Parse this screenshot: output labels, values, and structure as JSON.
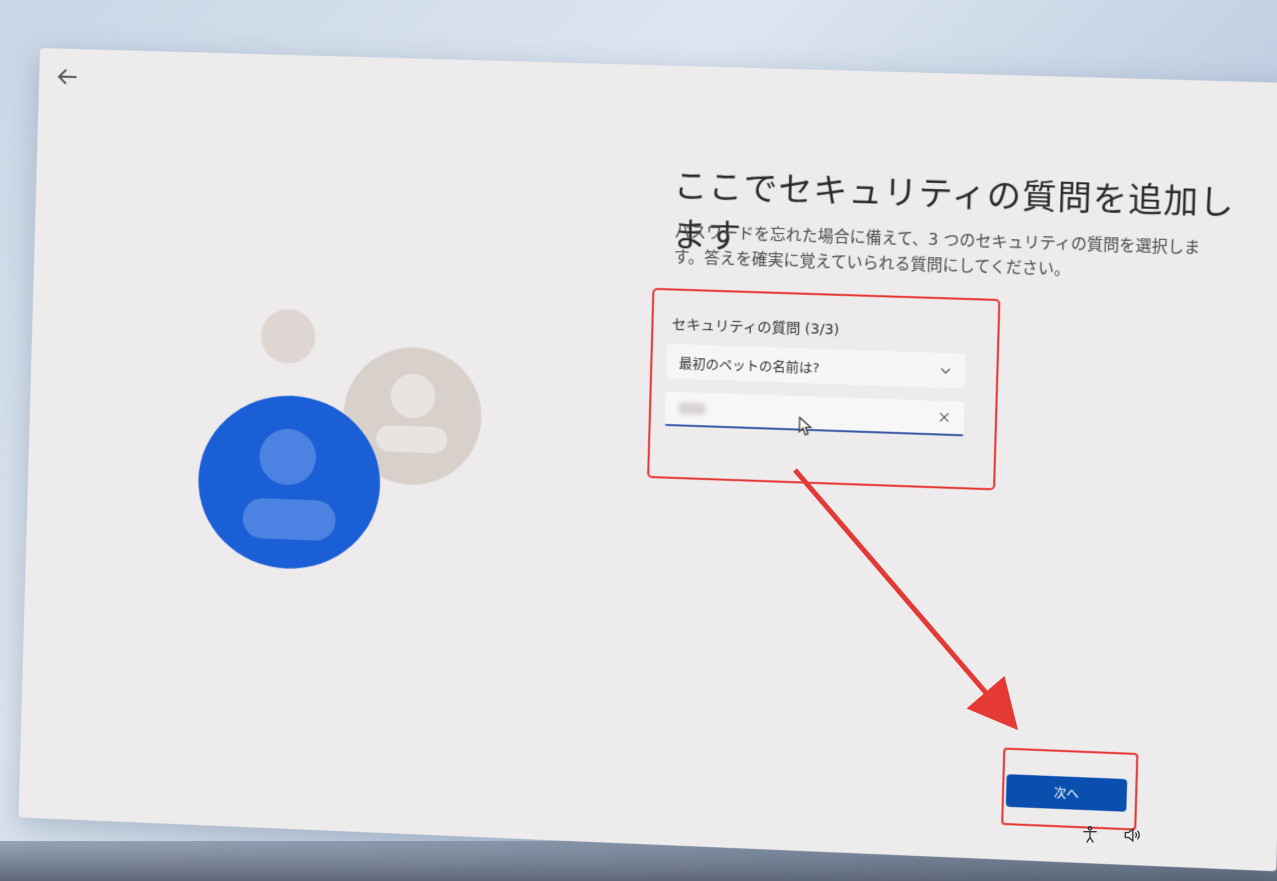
{
  "page": {
    "title": "ここでセキュリティの質問を追加します",
    "description": "パスワードを忘れた場合に備えて、3 つのセキュリティの質問を選択します。答えを確実に覚えていられる質問にしてください。"
  },
  "form": {
    "question_label": "セキュリティの質問 (3/3)",
    "selected_question": "最初のペットの名前は?"
  },
  "footer": {
    "next_label": "次へ"
  },
  "colors": {
    "accent": "#0a4fb0",
    "highlight": "#e53935",
    "avatar_primary": "#1a5fd6",
    "avatar_secondary": "#d8d0cb"
  },
  "icons": {
    "back": "arrow-left-icon",
    "dropdown": "chevron-down-icon",
    "clear": "close-icon",
    "accessibility": "accessibility-icon",
    "volume": "volume-icon"
  }
}
